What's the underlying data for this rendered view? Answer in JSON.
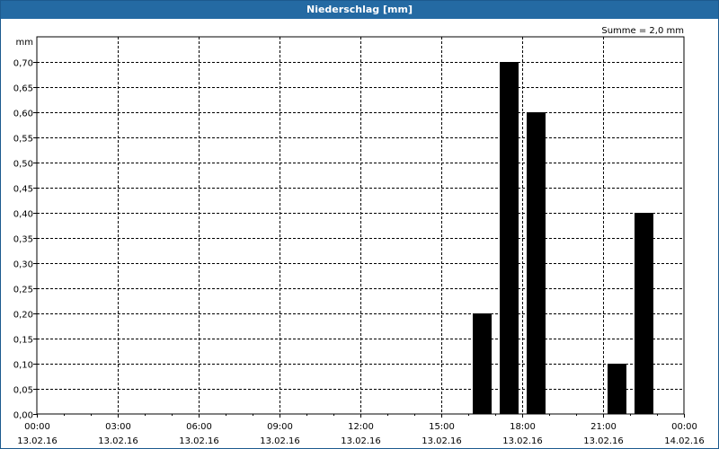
{
  "window": {
    "title": "Niederschlag [mm]"
  },
  "colors": {
    "titlebar": "#246aa3",
    "bar": "#000000",
    "grid": "#000000"
  },
  "chart_data": {
    "type": "bar",
    "title": "Niederschlag [mm]",
    "ylabel": "mm",
    "xlabel": "",
    "summary": "Summe = 2,0 mm",
    "ylim": [
      0,
      0.75
    ],
    "grid": true,
    "y_ticks": [
      "0,00",
      "0,05",
      "0,10",
      "0,15",
      "0,20",
      "0,25",
      "0,30",
      "0,35",
      "0,40",
      "0,45",
      "0,50",
      "0,55",
      "0,60",
      "0,65",
      "0,70"
    ],
    "y_tick_values": [
      0,
      0.05,
      0.1,
      0.15,
      0.2,
      0.25,
      0.3,
      0.35,
      0.4,
      0.45,
      0.5,
      0.55,
      0.6,
      0.65,
      0.7
    ],
    "x_range": [
      "13.02.16 00:00",
      "14.02.16 00:00"
    ],
    "x_ticks": [
      {
        "time": "00:00",
        "date": "13.02.16"
      },
      {
        "time": "03:00",
        "date": "13.02.16"
      },
      {
        "time": "06:00",
        "date": "13.02.16"
      },
      {
        "time": "09:00",
        "date": "13.02.16"
      },
      {
        "time": "12:00",
        "date": "13.02.16"
      },
      {
        "time": "15:00",
        "date": "13.02.16"
      },
      {
        "time": "18:00",
        "date": "13.02.16"
      },
      {
        "time": "21:00",
        "date": "13.02.16"
      },
      {
        "time": "00:00",
        "date": "14.02.16"
      }
    ],
    "bars": [
      {
        "time": "17:00",
        "value": 0.2
      },
      {
        "time": "18:00",
        "value": 0.7
      },
      {
        "time": "19:00",
        "value": 0.6
      },
      {
        "time": "22:00",
        "value": 0.1
      },
      {
        "time": "23:00",
        "value": 0.4
      }
    ]
  }
}
